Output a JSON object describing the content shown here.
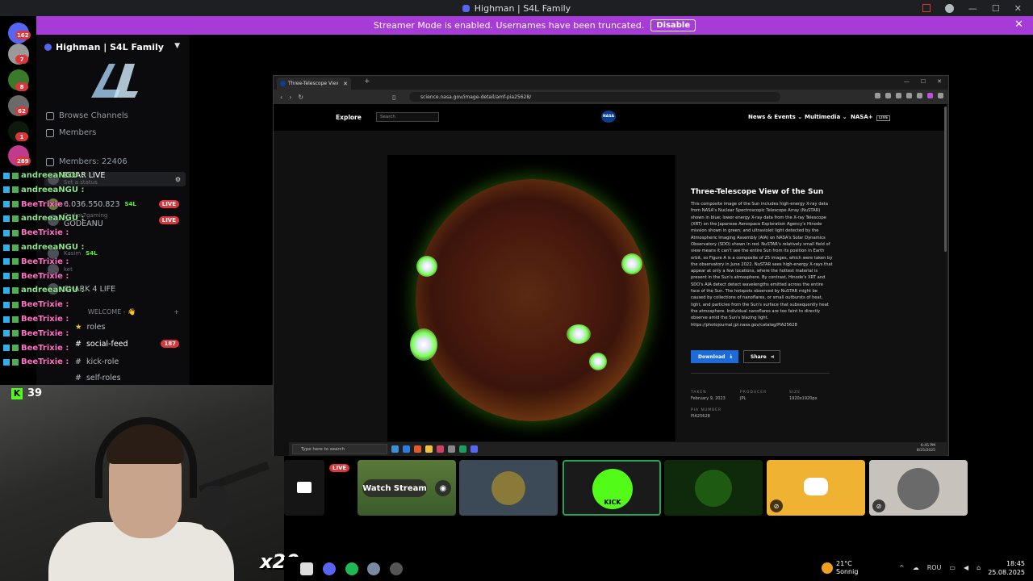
{
  "titlebar": {
    "title": "Highman | S4L Family"
  },
  "banner": {
    "text": "Streamer Mode is enabled. Usernames have been truncated.",
    "button": "Disable"
  },
  "rail": {
    "badges": [
      "162",
      "7",
      "8",
      "62",
      "1",
      "289"
    ]
  },
  "sidebar": {
    "server_name": "Highman | S4L Family",
    "browse": "Browse Channels",
    "members_link": "Members",
    "members_count": "Members: 22406",
    "channels": [
      {
        "label": "DOAR LIVE",
        "sub": "Set a status",
        "selected": true
      },
      {
        "label": "6.036.550.823",
        "tag": "S4L",
        "badge": "LIVE"
      },
      {
        "label": "GODEANU",
        "sub": "Darkor7gaming",
        "badge": "LIVE"
      },
      {
        "label": "Kasim",
        "tag": "S4L"
      },
      {
        "label": "ket"
      },
      {
        "label": "SHARK 4 LIFE"
      },
      {
        "label": "WELCOME - 👋"
      },
      {
        "label": "roles"
      },
      {
        "label": "social-feed",
        "badge": "187"
      },
      {
        "label": "kick-role"
      },
      {
        "label": "self-roles"
      }
    ]
  },
  "chat": {
    "messages": [
      {
        "user": "andreeaNGU :",
        "color": "green"
      },
      {
        "user": "andreeaNGU :",
        "color": "green"
      },
      {
        "user": "BeeTrixie :",
        "color": "pink"
      },
      {
        "user": "andreeaNGU :",
        "color": "green"
      },
      {
        "user": "BeeTrixie :",
        "color": "pink"
      },
      {
        "user": "andreeaNGU :",
        "color": "green"
      },
      {
        "user": "BeeTrixie :",
        "color": "pink"
      },
      {
        "user": "BeeTrixie :",
        "color": "pink"
      },
      {
        "user": "andreeaNGU :",
        "color": "green"
      },
      {
        "user": "BeeTrixie :",
        "color": "pink"
      },
      {
        "user": "BeeTrixie :",
        "color": "pink"
      },
      {
        "user": "BeeTrixie :",
        "color": "pink"
      },
      {
        "user": "BeeTrixie :",
        "color": "pink"
      },
      {
        "user": "BeeTrixie :",
        "color": "pink"
      }
    ]
  },
  "kick": {
    "count": "39",
    "multiplier": "x20"
  },
  "browser": {
    "tab_title": "Three-Telescope View of the Sun",
    "url": "science.nasa.gov/image-detail/amf-pia25628/",
    "nasa": {
      "explore": "Explore",
      "search_placeholder": "Search",
      "logo": "NASA",
      "menu_news": "News & Events",
      "menu_multimedia": "Multimedia",
      "menu_plus": "NASA+",
      "menu_plus_live": "LIVE"
    },
    "image": {
      "title": "Three-Telescope View of the Sun",
      "description": "This composite image of the Sun includes high-energy X-ray data from NASA's Nuclear Spectroscopic Telescope Array (NuSTAR) shown in blue; lower energy X-ray data from the X-ray Telescope (XRT) on the Japanese Aerospace Exploration Agency's Hinode mission shown in green; and ultraviolet light detected by the Atmospheric Imaging Assembly (AIA) on NASA's Solar Dynamics Observatory (SDO) shown in red. NuSTAR's relatively small field of view means it can't see the entire Sun from its position in Earth orbit, so Figure A is a composite of 25 images, which were taken by the observatory in June 2022. NuSTAR sees high-energy X-rays that appear at only a few locations, where the hottest material is present in the Sun's atmosphere. By contrast, Hinode's XRT and SDO's AIA detect detect wavelengths emitted across the entire face of the Sun. The hotspots observed by NuSTAR might be caused by collections of nanoflares, or small outbursts of heat, light, and particles from the Sun's surface that subsequently heat the atmosphere. Individual nanoflares are too faint to directly observe amid the Sun's blazing light. https://photojournal.jpl.nasa.gov/catalog/PIA25628",
      "download": "Download",
      "share": "Share",
      "taken_label": "TAKEN",
      "taken": "February 9, 2023",
      "producer_label": "PRODUCER",
      "producer": "JPL",
      "size_label": "SIZE",
      "size": "1920x1920px",
      "pia_label": "PIA NUMBER",
      "pia": "PIA25628"
    }
  },
  "inner_taskbar": {
    "search_placeholder": "Type here to search",
    "time": "6:45 PM",
    "date": "8/25/2025"
  },
  "tiles": {
    "live": "LIVE",
    "watch": "Watch Stream"
  },
  "taskbar": {
    "temp": "21°C",
    "weather": "Sonnig",
    "lang": "ROU",
    "time": "18:45",
    "date": "25.08.2025"
  }
}
